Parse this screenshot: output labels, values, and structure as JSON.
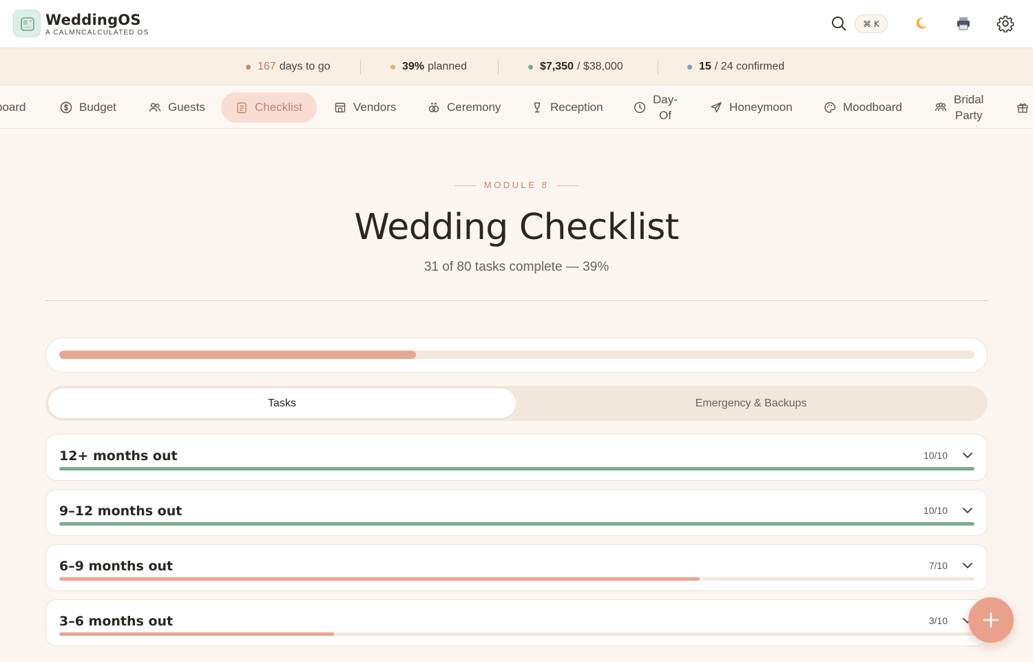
{
  "app": {
    "name": "WeddingOS",
    "tagline": "A CALMNCALCULATED OS"
  },
  "header": {
    "search_shortcut": "⌘ K",
    "theme_icon": "moon-icon",
    "print_icon": "printer-icon",
    "settings_icon": "gear-icon"
  },
  "stats": {
    "days": {
      "value": "167",
      "label": "days to go",
      "color": "#c47d62"
    },
    "planned": {
      "value": "39%",
      "label": "planned",
      "color": "#e8b66a"
    },
    "budget": {
      "value": "$7,350",
      "label": "/ $38,000",
      "color": "#78ad8c"
    },
    "rsvp": {
      "value": "15",
      "label": "/ 24 confirmed",
      "color": "#7fa1c9"
    }
  },
  "nav": {
    "items": [
      {
        "label": "board",
        "icon": "dashboard-icon"
      },
      {
        "label": "Budget",
        "icon": "dollar-icon"
      },
      {
        "label": "Guests",
        "icon": "users-icon"
      },
      {
        "label": "Checklist",
        "icon": "clipboard-icon",
        "active": true
      },
      {
        "label": "Vendors",
        "icon": "store-icon"
      },
      {
        "label": "Ceremony",
        "icon": "rings-icon"
      },
      {
        "label": "Reception",
        "icon": "glass-icon"
      },
      {
        "label_1": "Day-",
        "label_2": "Of",
        "icon": "clock-icon"
      },
      {
        "label": "Honeymoon",
        "icon": "plane-icon"
      },
      {
        "label": "Moodboard",
        "icon": "palette-icon"
      },
      {
        "label_1": "Bridal",
        "label_2": "Party",
        "icon": "people-icon"
      },
      {
        "icon": "gift-icon"
      }
    ]
  },
  "hero": {
    "module": "MODULE 8",
    "title": "Wedding Checklist",
    "subtitle": "31 of 80 tasks complete — 39%"
  },
  "overall_progress": {
    "fraction": 0.39,
    "color": "#e6a893"
  },
  "tabs": [
    {
      "label": "Tasks",
      "selected": true
    },
    {
      "label": "Emergency & Backups",
      "selected": false
    }
  ],
  "sections": [
    {
      "title": "12+ months out",
      "count": "10/10",
      "fraction": 1.0,
      "color": "#78ad8c"
    },
    {
      "title": "9–12 months out",
      "count": "10/10",
      "fraction": 1.0,
      "color": "#78ad8c"
    },
    {
      "title": "6–9 months out",
      "count": "7/10",
      "fraction": 0.7,
      "color": "#e6a893"
    },
    {
      "title": "3–6 months out",
      "count": "3/10",
      "fraction": 0.3,
      "color": "#e6a893"
    }
  ],
  "fab": {
    "icon": "plus-icon"
  }
}
